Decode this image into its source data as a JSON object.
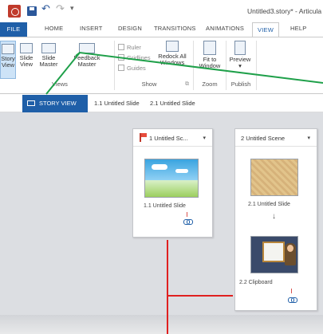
{
  "window": {
    "title": "Untitled3.story* - Articula"
  },
  "quick_access": {
    "save": "save-icon",
    "undo": "↶",
    "redo": "↷",
    "customize": "▾"
  },
  "tabs": [
    "FILE",
    "HOME",
    "INSERT",
    "DESIGN",
    "TRANSITIONS",
    "ANIMATIONS",
    "VIEW",
    "HELP"
  ],
  "active_tab": "VIEW",
  "ribbon": {
    "views": {
      "label": "Views",
      "buttons": [
        {
          "line1": "Story",
          "line2": "View"
        },
        {
          "line1": "Slide",
          "line2": "View"
        },
        {
          "line1": "Slide",
          "line2": "Master"
        },
        {
          "line1": "Feedback",
          "line2": "Master"
        }
      ]
    },
    "show": {
      "label": "Show",
      "checkboxes": [
        "Ruler",
        "Gridlines",
        "Guides"
      ],
      "redock_line1": "Redock All",
      "redock_line2": "Windows"
    },
    "zoom": {
      "label": "Zoom",
      "fit_line1": "Fit to",
      "fit_line2": "Window"
    },
    "publish": {
      "label": "Publish",
      "preview": "Preview"
    }
  },
  "story_tabs": [
    "STORY VIEW",
    "1.1 Untitled Slide",
    "2.1 Untitled Slide"
  ],
  "scenes": [
    {
      "title": "1 Untitled Sc...",
      "caret": "▾",
      "slides": [
        {
          "label": "1.1 Untitled Slide"
        }
      ]
    },
    {
      "title": "2 Untitled Scene",
      "caret": "▾",
      "slides": [
        {
          "label": "2.1 Untitled Slide"
        },
        {
          "label": "2.2 Clipboard"
        }
      ]
    }
  ],
  "colors": {
    "accent": "#1f5fa8",
    "annotation_line": "#1fa04a",
    "connector": "#e02020"
  }
}
